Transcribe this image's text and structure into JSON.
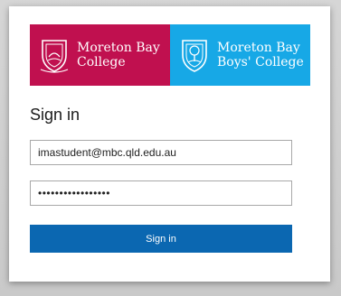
{
  "banner": {
    "left": {
      "line1": "Moreton Bay",
      "line2": "College",
      "color": "#c0104f",
      "icon": "mbc-crest-icon"
    },
    "right": {
      "line1": "Moreton Bay",
      "line2": "Boys' College",
      "color": "#17a8e6",
      "icon": "mbbc-crest-icon"
    }
  },
  "signin": {
    "title": "Sign in",
    "email_value": "imastudent@mbc.qld.edu.au",
    "password_masked": "•••••••••••••••••",
    "button_label": "Sign in",
    "button_color": "#0b67b1"
  }
}
